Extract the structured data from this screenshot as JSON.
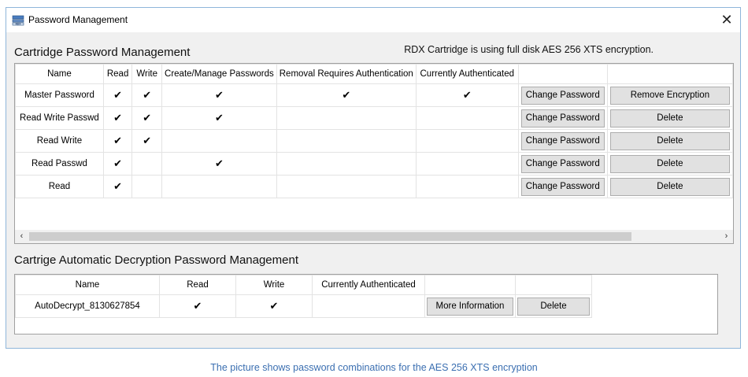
{
  "window": {
    "title": "Password Management",
    "close_glyph": "✕"
  },
  "cartridge": {
    "section_title": "Cartridge Password Management",
    "encryption_note": "RDX Cartridge is using full disk AES 256 XTS encryption.",
    "columns": [
      "Name",
      "Read",
      "Write",
      "Create/Manage Passwords",
      "Removal Requires Authentication",
      "Currently Authenticated",
      "",
      ""
    ],
    "rows": [
      {
        "name": "Master Password",
        "read": "✔",
        "write": "✔",
        "create": "✔",
        "removal": "✔",
        "auth": "✔",
        "action1": "Change Password",
        "action2": "Remove Encryption"
      },
      {
        "name": "Read Write Passwd",
        "read": "✔",
        "write": "✔",
        "create": "✔",
        "removal": "",
        "auth": "",
        "action1": "Change Password",
        "action2": "Delete"
      },
      {
        "name": "Read Write",
        "read": "✔",
        "write": "✔",
        "create": "",
        "removal": "",
        "auth": "",
        "action1": "Change Password",
        "action2": "Delete"
      },
      {
        "name": "Read Passwd",
        "read": "✔",
        "write": "",
        "create": "✔",
        "removal": "",
        "auth": "",
        "action1": "Change Password",
        "action2": "Delete"
      },
      {
        "name": "Read",
        "read": "✔",
        "write": "",
        "create": "",
        "removal": "",
        "auth": "",
        "action1": "Change Password",
        "action2": "Delete"
      }
    ],
    "scroll_left": "‹",
    "scroll_right": "›"
  },
  "autodecrypt": {
    "section_title": "Cartrige Automatic Decryption Password Management",
    "columns": [
      "Name",
      "Read",
      "Write",
      "Currently Authenticated",
      "",
      ""
    ],
    "rows": [
      {
        "name": "AutoDecrypt_8130627854",
        "read": "✔",
        "write": "✔",
        "auth": "",
        "action1": "More Information",
        "action2": "Delete"
      }
    ]
  },
  "caption": "The picture shows password combinations for the AES 256 XTS encryption",
  "colors": {
    "accent": "#3b6fb1",
    "border": "#8fb6da"
  },
  "icons": {
    "app": "rdx-drive-icon",
    "close": "close-icon"
  }
}
